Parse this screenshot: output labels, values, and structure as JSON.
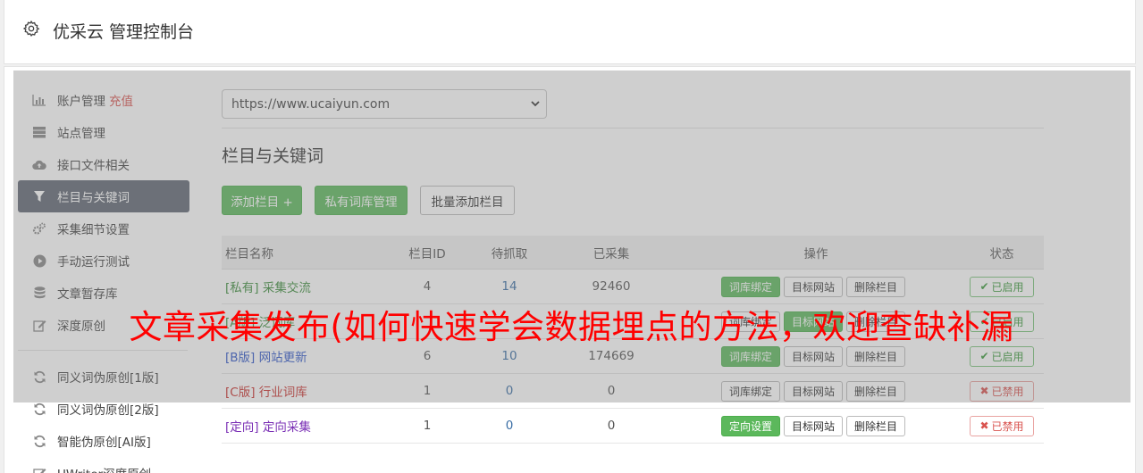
{
  "app": {
    "title": "优采云 管理控制台"
  },
  "sidebar": {
    "items": [
      {
        "label": "账户管理",
        "extra": "充值",
        "icon": "bar-chart-icon"
      },
      {
        "label": "站点管理",
        "icon": "server-icon"
      },
      {
        "label": "接口文件相关",
        "icon": "cloud-upload-icon"
      },
      {
        "label": "栏目与关键词",
        "icon": "filter-icon",
        "active": true
      },
      {
        "label": "采集细节设置",
        "icon": "cogs-icon"
      },
      {
        "label": "手动运行测试",
        "icon": "play-circle-icon"
      },
      {
        "label": "文章暂存库",
        "icon": "database-icon"
      },
      {
        "label": "深度原创",
        "icon": "edit-icon"
      },
      {
        "label": "同义词伪原创[1版]",
        "icon": "refresh-icon"
      },
      {
        "label": "同义词伪原创[2版]",
        "icon": "refresh-icon"
      },
      {
        "label": "智能伪原创[AI版]",
        "icon": "refresh-icon"
      },
      {
        "label": "UWriter深度原创",
        "icon": "edit-icon"
      }
    ]
  },
  "site_select": {
    "value": "https://www.ucaiyun.com"
  },
  "section": {
    "title": "栏目与关键词"
  },
  "toolbar": {
    "add_label": "添加栏目 +",
    "private_lib_label": "私有词库管理",
    "batch_add_label": "批量添加栏目"
  },
  "table": {
    "headers": [
      "栏目名称",
      "栏目ID",
      "待抓取",
      "已采集",
      "操作",
      "状态"
    ],
    "rows": [
      {
        "tag": "[私有]",
        "name": "采集交流",
        "color": "#3c8d3c",
        "id": "4",
        "wait": "14",
        "wait_blue": true,
        "done": "92460",
        "op1": "词库绑定",
        "op1_green": true,
        "op2": "目标网站",
        "op3": "删除栏目",
        "status": "已启用",
        "status_on": true
      },
      {
        "tag": "[A版]",
        "name": "泛词库",
        "color": "#3c8d3c",
        "id": "",
        "wait": "",
        "wait_blue": true,
        "done": "",
        "op1": "词库绑定",
        "op1_green": false,
        "op2": "目标网站",
        "op2_green": true,
        "op3": "删除栏目",
        "status": "已启用",
        "status_on": true
      },
      {
        "tag": "[B版]",
        "name": "网站更新",
        "color": "#2f56c9",
        "id": "6",
        "wait": "10",
        "wait_blue": true,
        "done": "174669",
        "op1": "词库绑定",
        "op1_green": true,
        "op2": "目标网站",
        "op3": "删除栏目",
        "status": "已启用",
        "status_on": true
      },
      {
        "tag": "[C版]",
        "name": "行业词库",
        "color": "#c9302c",
        "id": "1",
        "wait": "0",
        "wait_blue": true,
        "done": "0",
        "op1": "词库绑定",
        "op1_green": false,
        "op2": "目标网站",
        "op3": "删除栏目",
        "status": "已禁用",
        "status_on": false
      },
      {
        "tag": "[定向]",
        "name": "定向采集",
        "color": "#7a2fb5",
        "id": "1",
        "wait": "0",
        "wait_blue": true,
        "done": "0",
        "op1": "定向设置",
        "op1_green": true,
        "op2": "目标网站",
        "op3": "删除栏目",
        "status": "已禁用",
        "status_on": false
      }
    ]
  },
  "banner": {
    "text": "文章采集发布(如何快速学会数据埋点的方法，欢迎查缺补漏"
  }
}
